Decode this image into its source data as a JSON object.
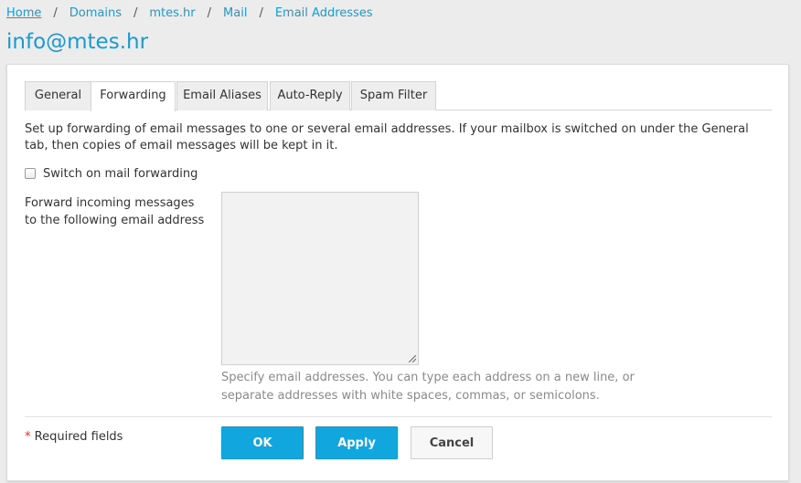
{
  "breadcrumb": {
    "items": [
      "Home",
      "Domains",
      "mtes.hr",
      "Mail",
      "Email Addresses"
    ],
    "separator": "/"
  },
  "page": {
    "title": "info@mtes.hr"
  },
  "tabs": [
    {
      "label": "General",
      "active": false
    },
    {
      "label": "Forwarding",
      "active": true
    },
    {
      "label": "Email Aliases",
      "active": false
    },
    {
      "label": "Auto-Reply",
      "active": false
    },
    {
      "label": "Spam Filter",
      "active": false
    }
  ],
  "forwarding": {
    "description": "Set up forwarding of email messages to one or several email addresses. If your mailbox is switched on under the General tab, then copies of email messages will be kept in it.",
    "checkbox_label": "Switch on mail forwarding",
    "checkbox_checked": false,
    "field_label": "Forward incoming messages to the following email address",
    "textarea_value": "",
    "hint": "Specify email addresses. You can type each address on a new line, or separate addresses with white spaces, commas, or semicolons."
  },
  "footer": {
    "required_star": "*",
    "required_text": "Required fields",
    "ok_label": "OK",
    "apply_label": "Apply",
    "cancel_label": "Cancel"
  },
  "colors": {
    "accent": "#1a9ad0",
    "primary_button": "#12a6de",
    "required_star": "#d9352b"
  }
}
